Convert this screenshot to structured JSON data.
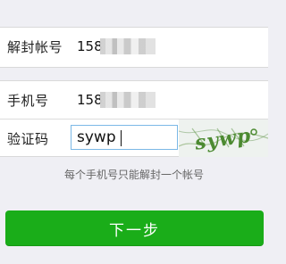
{
  "form": {
    "account_label": "解封帐号",
    "account_prefix": "158",
    "phone_label": "手机号",
    "phone_prefix": "158",
    "captcha_label": "验证码",
    "captcha_value": "sywp",
    "captcha_image_text": "sywp",
    "hint": "每个手机号只能解封一个帐号",
    "next_button": "下一步"
  },
  "colors": {
    "page_background": "#efeff4",
    "input_border": "#7bb8e6",
    "primary_button": "#1aad19",
    "captcha_text": "#4c8a31"
  },
  "icons": {
    "captcha": "captcha-image"
  }
}
